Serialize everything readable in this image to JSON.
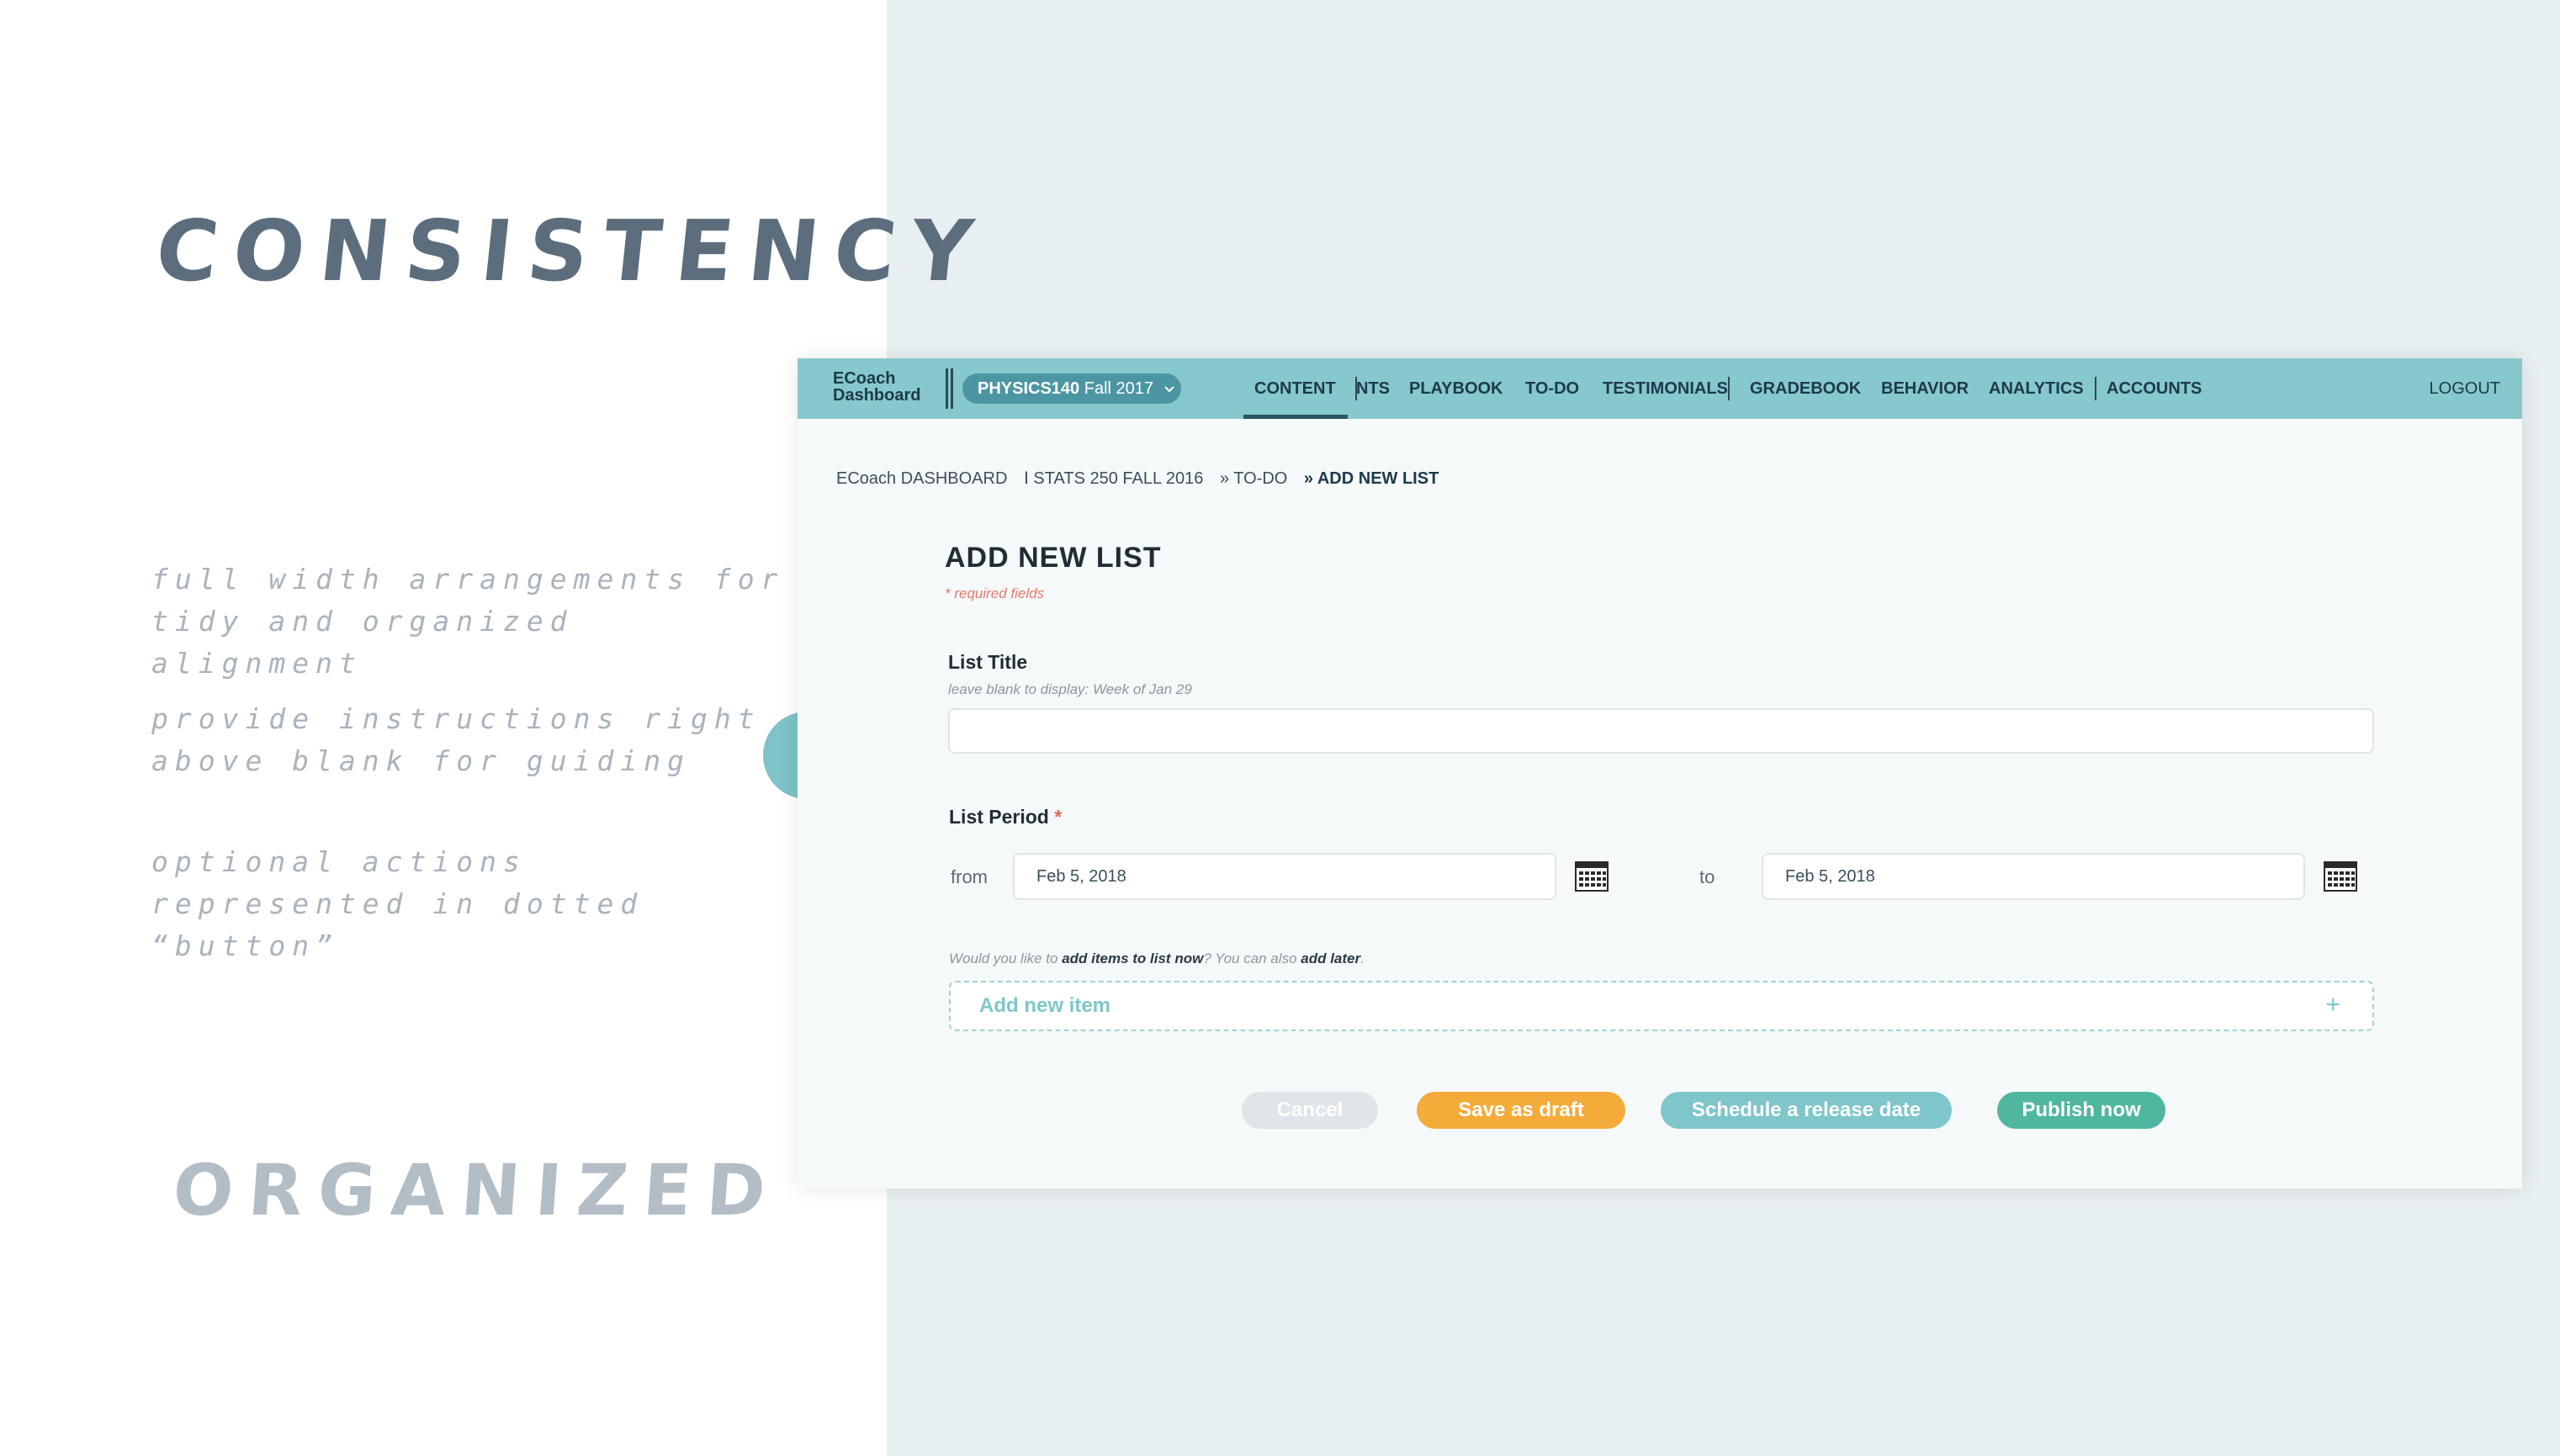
{
  "slide": {
    "headline_top": "CONSISTENCY",
    "headline_bottom": "ORGANIZED",
    "notes": [
      "full width arrangements for tidy and organized alignment",
      "provide instructions right above blank for guiding",
      "optional actions represented in dotted “button”"
    ]
  },
  "header": {
    "brand_line1": "ECoach",
    "brand_line2": "Dashboard",
    "course_code": "PHYSICS140",
    "course_term": "Fall 2017",
    "nav": [
      "CONTENT",
      "NTS",
      "PLAYBOOK",
      "TO-DO",
      "TESTIMONIALS",
      "GRADEBOOK",
      "BEHAVIOR",
      "ANALYTICS",
      "ACCOUNTS"
    ],
    "active_nav": "CONTENT",
    "logout": "LOGOUT"
  },
  "breadcrumb": [
    "ECoach DASHBOARD",
    "Ⅰ STATS 250 FALL 2016",
    "» TO-DO",
    "» ADD NEW LIST"
  ],
  "form": {
    "title": "ADD NEW LIST",
    "required_note": "* required fields",
    "list_title_label": "List Title",
    "list_title_hint": "leave blank to display: Week of Jan 29",
    "list_title_value": "",
    "list_period_label": "List Period",
    "required_star": "*",
    "from_label": "from",
    "to_label": "to",
    "from_value": "Feb 5, 2018",
    "to_value": "Feb 5, 2018",
    "add_prompt_1": "Would you like to ",
    "add_prompt_bold_1": "add items to list now",
    "add_prompt_2": "? You can also ",
    "add_prompt_bold_2": "add later",
    "add_prompt_3": ".",
    "add_item_label": "Add new item",
    "add_item_plus": "+"
  },
  "buttons": {
    "cancel": "Cancel",
    "draft": "Save as draft",
    "schedule": "Schedule a release date",
    "publish": "Publish now"
  },
  "colors": {
    "topbar": "#86c8cb",
    "course_pill": "#4b96a2",
    "draft": "#f5ab3a",
    "schedule": "#7ec6ca",
    "publish": "#4fb79f",
    "cancel": "#dfe5e8"
  }
}
